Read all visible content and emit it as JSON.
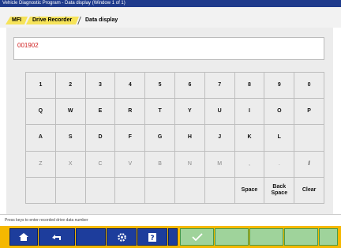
{
  "window": {
    "title": "Vehicle Diagnostic Program - Data display (Window 1 of 1)"
  },
  "tabs": [
    "MFI",
    "Drive Recorder",
    "Data display"
  ],
  "entry": {
    "value": "001902"
  },
  "keyboard": {
    "rows": [
      [
        "1",
        "2",
        "3",
        "4",
        "5",
        "6",
        "7",
        "8",
        "9",
        "0"
      ],
      [
        "Q",
        "W",
        "E",
        "R",
        "T",
        "Y",
        "U",
        "I",
        "O",
        "P"
      ],
      [
        "A",
        "S",
        "D",
        "F",
        "G",
        "H",
        "J",
        "K",
        "L",
        ""
      ],
      [
        "Z",
        "X",
        "C",
        "V",
        "B",
        "N",
        "M",
        ",",
        ".",
        "/"
      ],
      [
        "",
        "",
        "",
        "",
        "",
        "",
        "",
        "Space",
        "Back Space",
        "Clear"
      ]
    ],
    "dim_row": 3,
    "dim_cells": [
      7,
      8
    ]
  },
  "status": {
    "text": "Press keys to enter recorded drive data number"
  },
  "icons": {
    "home": "home-icon",
    "back": "back-icon",
    "settings": "settings-icon",
    "help": "help-icon",
    "ok": "checkmark-icon"
  },
  "colors": {
    "accent": "#f5b800",
    "taskbar_blue": "#1d3d9c",
    "taskbar_green": "#9fd39b",
    "title_blue": "#1f3b8c",
    "entry_text": "#d02020"
  }
}
